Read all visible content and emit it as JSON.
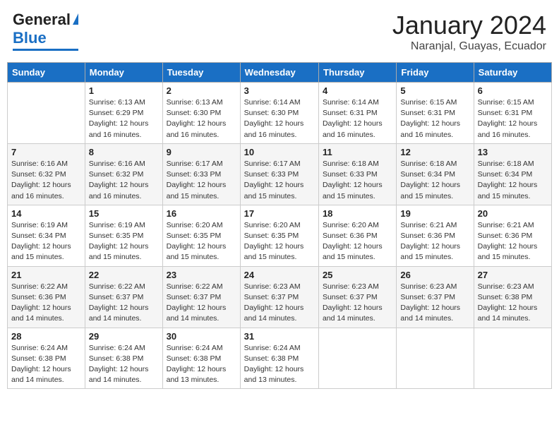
{
  "header": {
    "logo_general": "General",
    "logo_blue": "Blue",
    "title": "January 2024",
    "subtitle": "Naranjal, Guayas, Ecuador"
  },
  "columns": [
    "Sunday",
    "Monday",
    "Tuesday",
    "Wednesday",
    "Thursday",
    "Friday",
    "Saturday"
  ],
  "weeks": [
    [
      {
        "day": "",
        "info": ""
      },
      {
        "day": "1",
        "info": "Sunrise: 6:13 AM\nSunset: 6:29 PM\nDaylight: 12 hours and 16 minutes."
      },
      {
        "day": "2",
        "info": "Sunrise: 6:13 AM\nSunset: 6:30 PM\nDaylight: 12 hours and 16 minutes."
      },
      {
        "day": "3",
        "info": "Sunrise: 6:14 AM\nSunset: 6:30 PM\nDaylight: 12 hours and 16 minutes."
      },
      {
        "day": "4",
        "info": "Sunrise: 6:14 AM\nSunset: 6:31 PM\nDaylight: 12 hours and 16 minutes."
      },
      {
        "day": "5",
        "info": "Sunrise: 6:15 AM\nSunset: 6:31 PM\nDaylight: 12 hours and 16 minutes."
      },
      {
        "day": "6",
        "info": "Sunrise: 6:15 AM\nSunset: 6:31 PM\nDaylight: 12 hours and 16 minutes."
      }
    ],
    [
      {
        "day": "7",
        "info": "Sunrise: 6:16 AM\nSunset: 6:32 PM\nDaylight: 12 hours and 16 minutes."
      },
      {
        "day": "8",
        "info": "Sunrise: 6:16 AM\nSunset: 6:32 PM\nDaylight: 12 hours and 16 minutes."
      },
      {
        "day": "9",
        "info": "Sunrise: 6:17 AM\nSunset: 6:33 PM\nDaylight: 12 hours and 15 minutes."
      },
      {
        "day": "10",
        "info": "Sunrise: 6:17 AM\nSunset: 6:33 PM\nDaylight: 12 hours and 15 minutes."
      },
      {
        "day": "11",
        "info": "Sunrise: 6:18 AM\nSunset: 6:33 PM\nDaylight: 12 hours and 15 minutes."
      },
      {
        "day": "12",
        "info": "Sunrise: 6:18 AM\nSunset: 6:34 PM\nDaylight: 12 hours and 15 minutes."
      },
      {
        "day": "13",
        "info": "Sunrise: 6:18 AM\nSunset: 6:34 PM\nDaylight: 12 hours and 15 minutes."
      }
    ],
    [
      {
        "day": "14",
        "info": "Sunrise: 6:19 AM\nSunset: 6:34 PM\nDaylight: 12 hours and 15 minutes."
      },
      {
        "day": "15",
        "info": "Sunrise: 6:19 AM\nSunset: 6:35 PM\nDaylight: 12 hours and 15 minutes."
      },
      {
        "day": "16",
        "info": "Sunrise: 6:20 AM\nSunset: 6:35 PM\nDaylight: 12 hours and 15 minutes."
      },
      {
        "day": "17",
        "info": "Sunrise: 6:20 AM\nSunset: 6:35 PM\nDaylight: 12 hours and 15 minutes."
      },
      {
        "day": "18",
        "info": "Sunrise: 6:20 AM\nSunset: 6:36 PM\nDaylight: 12 hours and 15 minutes."
      },
      {
        "day": "19",
        "info": "Sunrise: 6:21 AM\nSunset: 6:36 PM\nDaylight: 12 hours and 15 minutes."
      },
      {
        "day": "20",
        "info": "Sunrise: 6:21 AM\nSunset: 6:36 PM\nDaylight: 12 hours and 15 minutes."
      }
    ],
    [
      {
        "day": "21",
        "info": "Sunrise: 6:22 AM\nSunset: 6:36 PM\nDaylight: 12 hours and 14 minutes."
      },
      {
        "day": "22",
        "info": "Sunrise: 6:22 AM\nSunset: 6:37 PM\nDaylight: 12 hours and 14 minutes."
      },
      {
        "day": "23",
        "info": "Sunrise: 6:22 AM\nSunset: 6:37 PM\nDaylight: 12 hours and 14 minutes."
      },
      {
        "day": "24",
        "info": "Sunrise: 6:23 AM\nSunset: 6:37 PM\nDaylight: 12 hours and 14 minutes."
      },
      {
        "day": "25",
        "info": "Sunrise: 6:23 AM\nSunset: 6:37 PM\nDaylight: 12 hours and 14 minutes."
      },
      {
        "day": "26",
        "info": "Sunrise: 6:23 AM\nSunset: 6:37 PM\nDaylight: 12 hours and 14 minutes."
      },
      {
        "day": "27",
        "info": "Sunrise: 6:23 AM\nSunset: 6:38 PM\nDaylight: 12 hours and 14 minutes."
      }
    ],
    [
      {
        "day": "28",
        "info": "Sunrise: 6:24 AM\nSunset: 6:38 PM\nDaylight: 12 hours and 14 minutes."
      },
      {
        "day": "29",
        "info": "Sunrise: 6:24 AM\nSunset: 6:38 PM\nDaylight: 12 hours and 14 minutes."
      },
      {
        "day": "30",
        "info": "Sunrise: 6:24 AM\nSunset: 6:38 PM\nDaylight: 12 hours and 13 minutes."
      },
      {
        "day": "31",
        "info": "Sunrise: 6:24 AM\nSunset: 6:38 PM\nDaylight: 12 hours and 13 minutes."
      },
      {
        "day": "",
        "info": ""
      },
      {
        "day": "",
        "info": ""
      },
      {
        "day": "",
        "info": ""
      }
    ]
  ]
}
